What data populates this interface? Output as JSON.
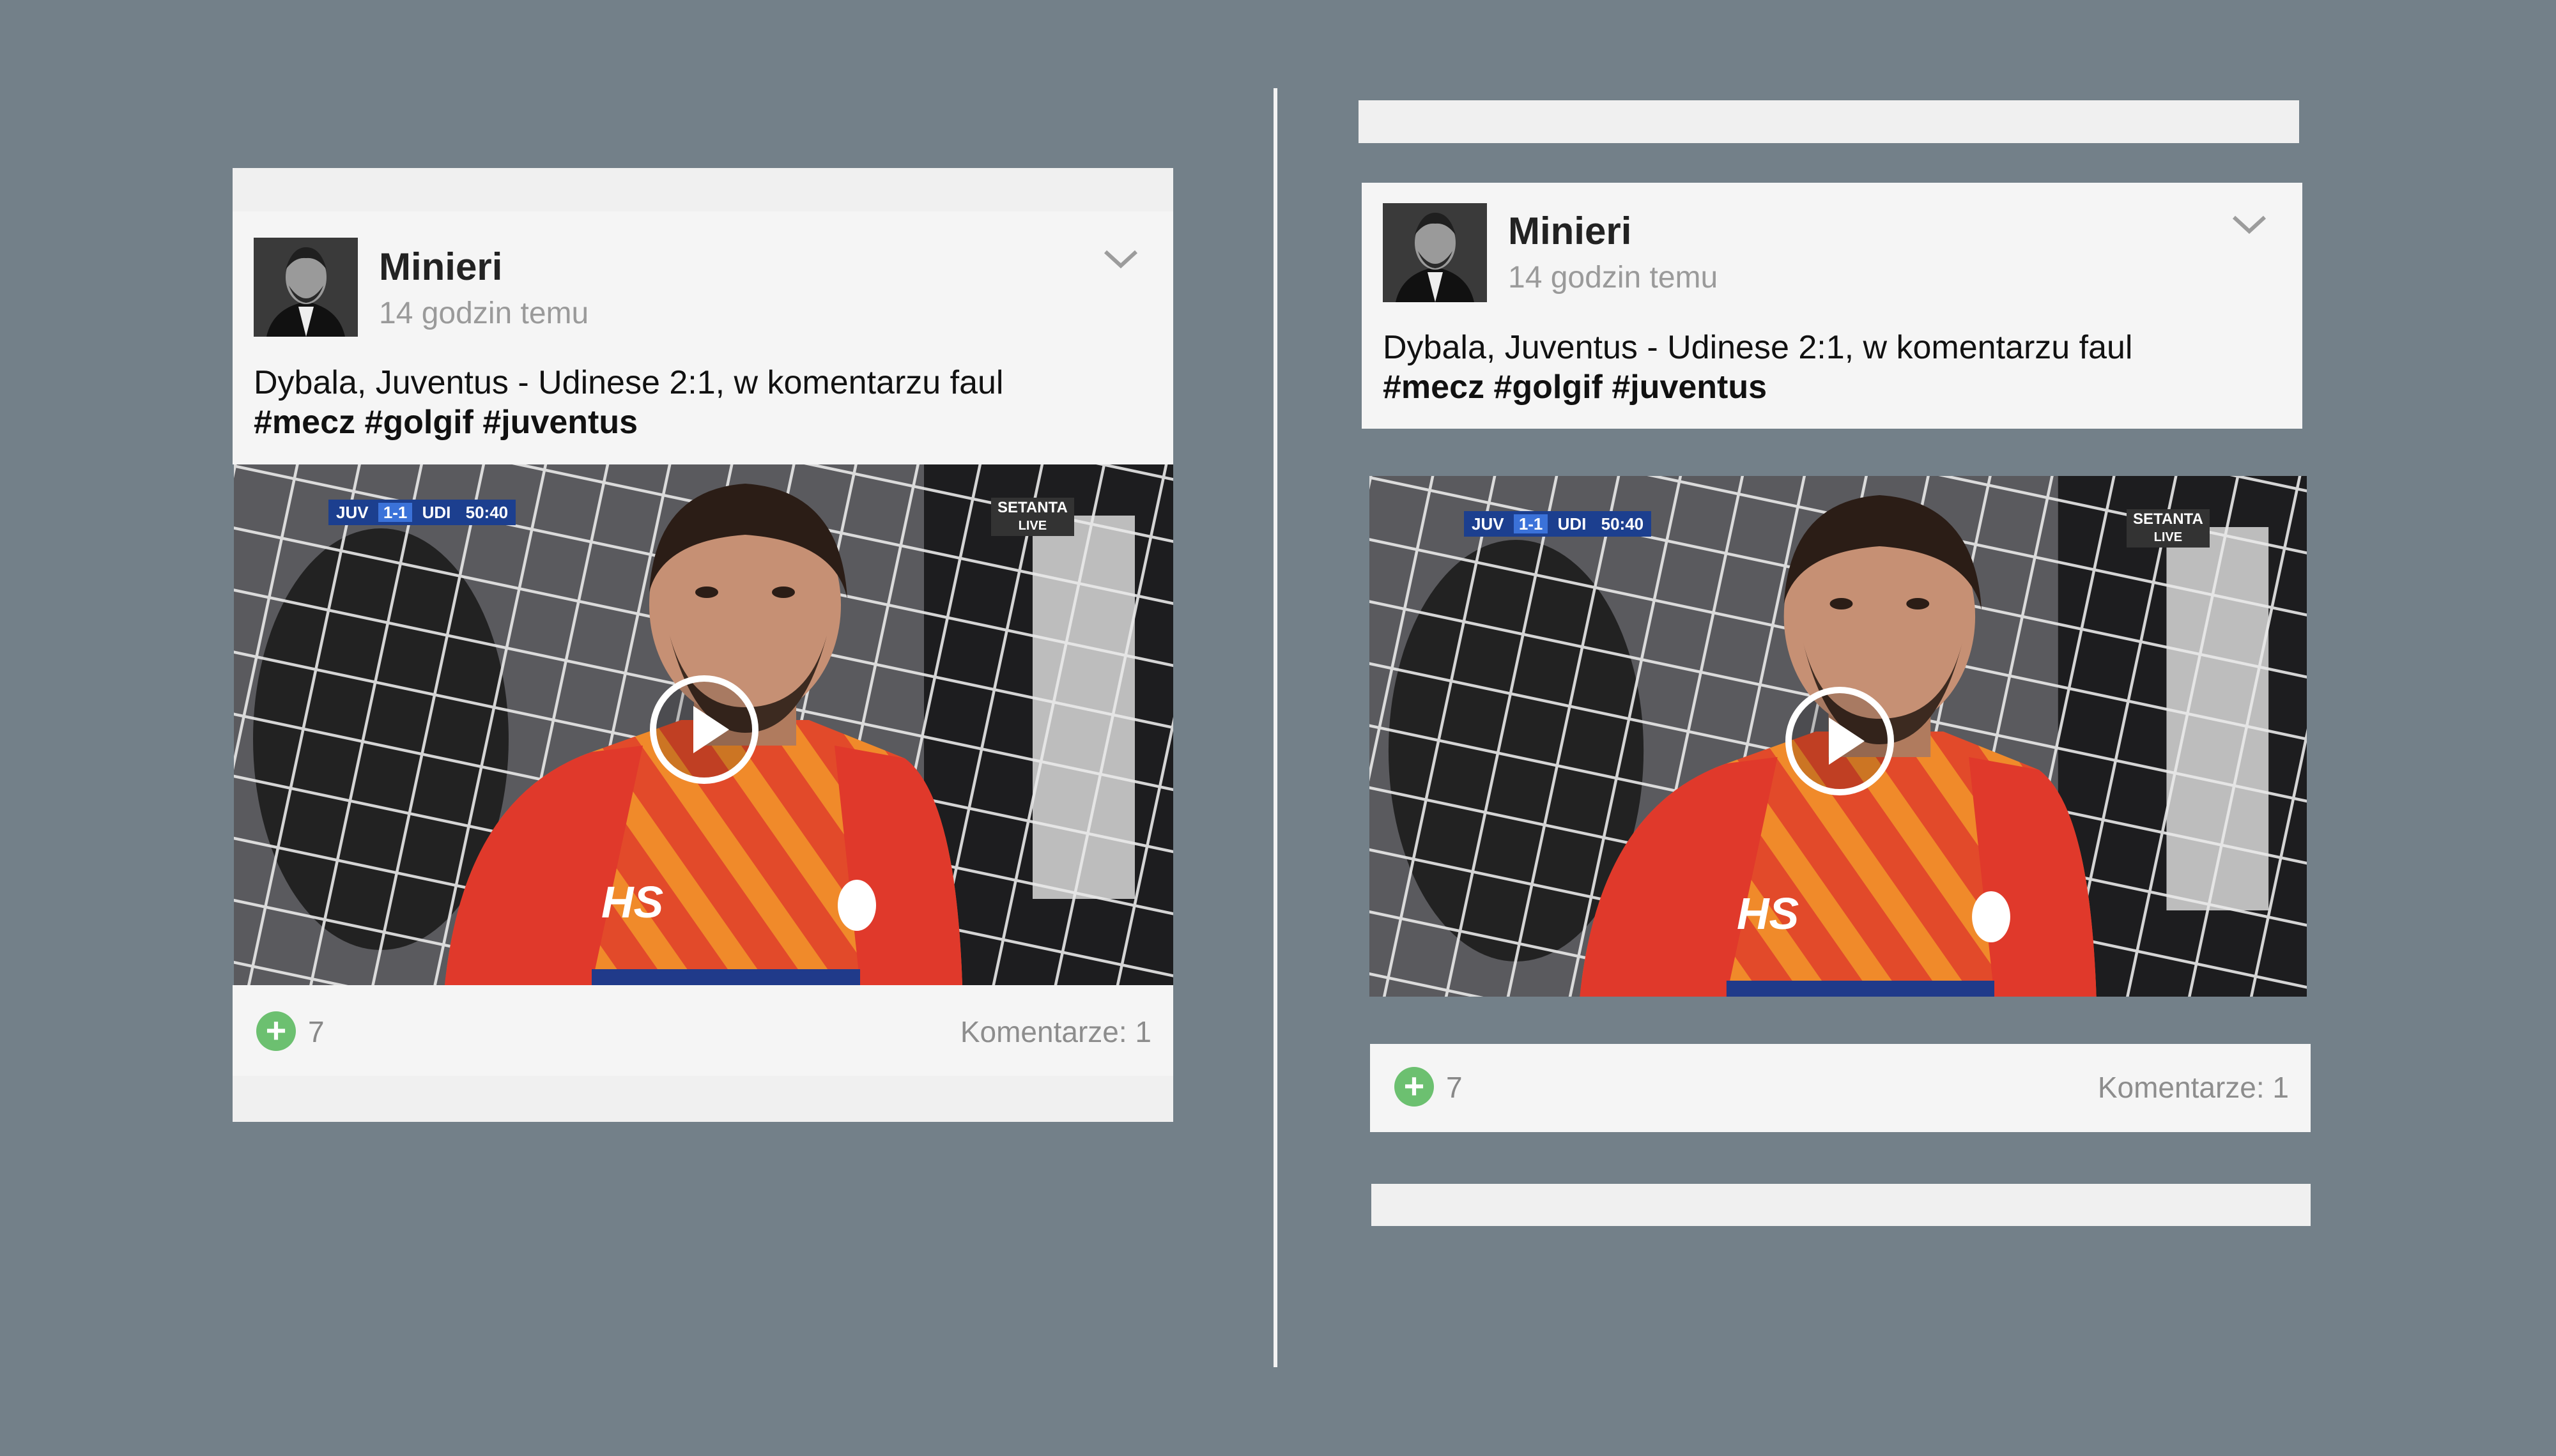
{
  "posts": [
    {
      "author": "Minieri",
      "time_ago": "14 godzin temu",
      "text": "Dybala, Juventus - Udinese 2:1, w komentarzu faul",
      "hashtags": "#mecz #golgif #juventus",
      "score_bug": {
        "home": "JUV",
        "score": "1-1",
        "away": "UDI",
        "clock": "50:40"
      },
      "broadcaster": "SETANTA",
      "broadcaster_live": "LIVE",
      "shirt_logo": "HS",
      "plus_count": "7",
      "comments_label": "Komentarze: 1"
    },
    {
      "author": "Minieri",
      "time_ago": "14 godzin temu",
      "text": "Dybala, Juventus - Udinese 2:1, w komentarzu faul",
      "hashtags": "#mecz #golgif #juventus",
      "score_bug": {
        "home": "JUV",
        "score": "1-1",
        "away": "UDI",
        "clock": "50:40"
      },
      "broadcaster": "SETANTA",
      "broadcaster_live": "LIVE",
      "shirt_logo": "HS",
      "plus_count": "7",
      "comments_label": "Komentarze: 1"
    }
  ],
  "icons": {
    "avatar": "avatar-portrait",
    "menu": "chevron-down-icon",
    "play": "play-icon",
    "plus": "plus-icon"
  },
  "colors": {
    "background": "#738089",
    "card": "#f5f5f5",
    "plus_green": "#6cc070",
    "jersey": "#e0392b"
  }
}
